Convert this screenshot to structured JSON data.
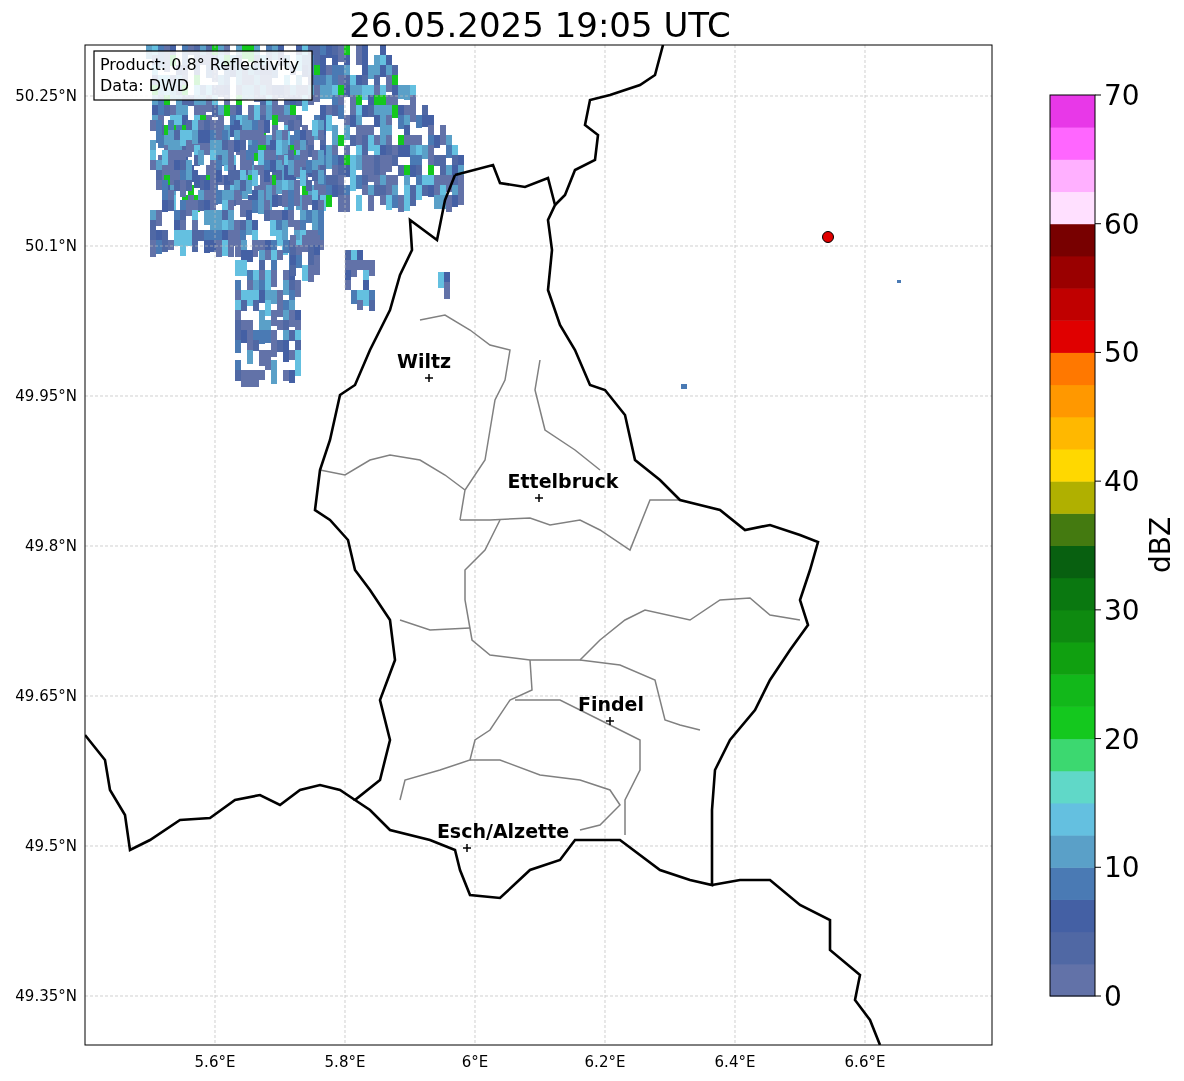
{
  "title": "26.05.2025 19:05 UTC",
  "info_box": [
    "Product: 0.8° Reflectivity",
    "Data: DWD"
  ],
  "map": {
    "y_ticks": [
      "50.25°N",
      "50.1°N",
      "49.95°N",
      "49.8°N",
      "49.65°N",
      "49.5°N",
      "49.35°N"
    ],
    "x_ticks": [
      "5.6°E",
      "5.8°E",
      "6°E",
      "6.2°E",
      "6.4°E",
      "6.6°E"
    ],
    "cities": [
      {
        "name": "Wiltz"
      },
      {
        "name": "Ettelbruck"
      },
      {
        "name": "Findel"
      },
      {
        "name": "Esch/Alzette"
      }
    ]
  },
  "colorbar": {
    "label": "dBZ",
    "ticks": [
      "70",
      "60",
      "50",
      "40",
      "30",
      "20",
      "10",
      "0"
    ],
    "colors": [
      {
        "color": "#6272a8"
      },
      {
        "color": "#5068a4"
      },
      {
        "color": "#4460a4"
      },
      {
        "color": "#4a7ab4"
      },
      {
        "color": "#5aa0c8"
      },
      {
        "color": "#64c0e0"
      },
      {
        "color": "#60d8c8"
      },
      {
        "color": "#3cd870"
      },
      {
        "color": "#14c81e"
      },
      {
        "color": "#12b81a"
      },
      {
        "color": "#10a010"
      },
      {
        "color": "#0e8a10"
      },
      {
        "color": "#0a7810"
      },
      {
        "color": "#086010"
      },
      {
        "color": "#447a10"
      },
      {
        "color": "#b0b000"
      },
      {
        "color": "#ffd800"
      },
      {
        "color": "#ffb800"
      },
      {
        "color": "#ff9800"
      },
      {
        "color": "#ff7800"
      },
      {
        "color": "#e00000"
      },
      {
        "color": "#c00000"
      },
      {
        "color": "#9a0000"
      },
      {
        "color": "#780000"
      },
      {
        "color": "#ffe0ff"
      },
      {
        "color": "#ffb0ff"
      },
      {
        "color": "#ff66ff"
      },
      {
        "color": "#e838e8"
      }
    ]
  }
}
